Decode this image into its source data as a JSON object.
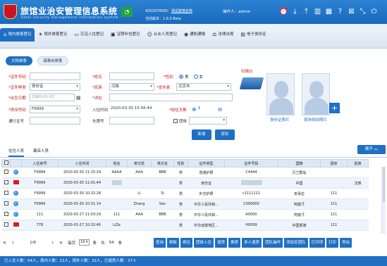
{
  "header": {
    "title": "旅馆业治安管理信息系统",
    "subtitle": "hotel security management information system",
    "code_line": "4201670005：",
    "hotel_name": "测试旅馆名称",
    "version": "当前版本：1.6.0 Beta",
    "operator": "操作人：admin"
  },
  "nav": {
    "items": [
      {
        "label": "境内旅客登记",
        "icon": "⌂",
        "active": true
      },
      {
        "label": "境外旅客登记",
        "icon": "✈",
        "active": false
      },
      {
        "label": "忘证入住登记",
        "icon": "▭",
        "active": false
      },
      {
        "label": "证照补包登记",
        "icon": "▣",
        "active": false
      },
      {
        "label": "从业人员登记",
        "icon": "☺",
        "active": false
      },
      {
        "label": "通知通报",
        "icon": "◉",
        "active": false
      },
      {
        "label": "法律法规",
        "icon": "⚖",
        "active": false
      },
      {
        "label": "电子身份证",
        "icon": "▤",
        "active": false
      }
    ]
  },
  "subtabs": [
    "大陆旅客",
    "港澳台旅客"
  ],
  "form": {
    "id_no_label": "*证件号码",
    "name_label": "*姓名",
    "gender_label": "*性别",
    "gender_male": "男",
    "gender_female": "女",
    "id_type_label": "*证件种类",
    "id_type_value": "身份证",
    "ethnic_label": "*民族",
    "ethnic_value": "汉族",
    "region_label": "*省市县",
    "region_value": "北京市",
    "birth_label": "*出生日期",
    "birth_value": "1980-01-01",
    "address_label": "*详址",
    "room_label": "*房间号码",
    "room_value": "F9999",
    "checkin_label": "入住时间",
    "checkin_value": "2020-03-30 15:56:44",
    "days_label": "*拟住天数",
    "days_value": "1",
    "pass_label": "通行证号",
    "plate_label": "车牌号",
    "group_label": "团体",
    "add_label": "新增",
    "save_label": "保存"
  },
  "scanner_label": "扫描仪",
  "photos": {
    "id_photo_label": "身份证照片",
    "live_photo_label": "现场抓拍照片"
  },
  "table_tabs": [
    "在住人员",
    "离店人员"
  ],
  "expand_label": "展开",
  "table": {
    "headers": [
      "",
      "",
      "入住房号",
      "入住时间",
      "姓名",
      "英文姓",
      "英文名",
      "性别",
      "证件类型",
      "证件号码",
      "国籍",
      "团体",
      "民族"
    ],
    "rows": [
      {
        "icon": "ie",
        "room": "F9999",
        "time": "2020-03-30 11:15:29",
        "name": "AAAA",
        "en_last": "AAA",
        "en_first": "BBB",
        "sex": "男",
        "doc": "普通护照",
        "doc_no": "C4444",
        "nation": "贝兰群岛",
        "group": "",
        "ethnic": ""
      },
      {
        "icon": "flag",
        "room": "F9999",
        "time": "2020-03-30 11:01:44",
        "name": "",
        "en_last": "",
        "en_first": "",
        "sex": "男",
        "doc": "身份证",
        "doc_no": "",
        "nation": "中国",
        "group": "",
        "ethnic": "汉族"
      },
      {
        "icon": "ie",
        "room": "F9999",
        "time": "2020-03-30 10:32:28",
        "name": "",
        "en_last": "Li",
        "en_first": "Si",
        "sex": "男",
        "doc": "外交护照",
        "doc_no": "c1111111",
        "nation": "安哥拉",
        "group": "111",
        "ethnic": ""
      },
      {
        "icon": "ie",
        "room": "F9999",
        "time": "2020-03-30 10:31:14",
        "name": "",
        "en_last": "Zhang",
        "en_first": "San",
        "sex": "男",
        "doc": "中华人民共和...",
        "doc_no": "C000000",
        "nation": "阿富汗",
        "group": "111",
        "ethnic": ""
      },
      {
        "icon": "ie",
        "room": "111",
        "time": "2020-03-27 11:03:29",
        "name": "111",
        "en_last": "AAA",
        "en_first": "BBB",
        "sex": "男",
        "doc": "中华人民共和...",
        "doc_no": "A0000",
        "nation": "阿富汗",
        "group": "111",
        "ethnic": ""
      },
      {
        "icon": "flag",
        "room": "778",
        "time": "2020-03-27 10:32:46",
        "name": "LiZe",
        "en_last": "",
        "en_first": "",
        "sex": "男",
        "doc": "中华动境地区...",
        "doc_no": "H0009",
        "nation": "中国香港",
        "group": "111",
        "ethnic": ""
      }
    ]
  },
  "pager": {
    "page": "1/6",
    "per_page_label": "每页",
    "per_page": "10",
    "unit": "条",
    "total_label": "共",
    "total": "54",
    "total_unit": "条"
  },
  "actions": [
    "查询",
    "刷新",
    "续住",
    "团体入住",
    "退房",
    "换房",
    "多人退房",
    "团队操作",
    "添加至团队",
    "打印项",
    "打印",
    "导出"
  ],
  "status": "已入住人数：54人，境内人数：22人，境外人数：32人，已退房人数：37人"
}
